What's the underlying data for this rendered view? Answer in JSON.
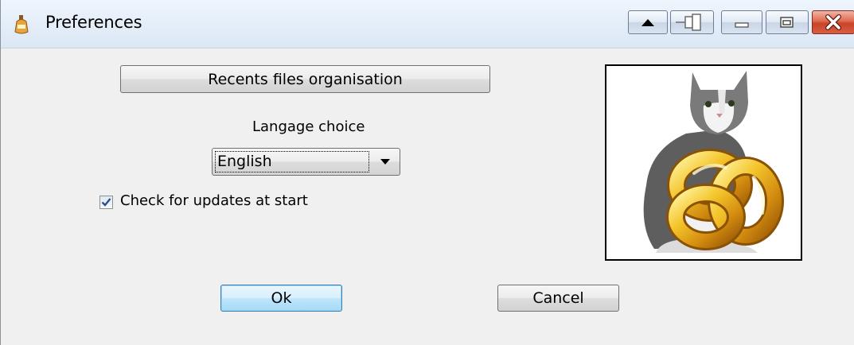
{
  "window": {
    "title": "Preferences",
    "icon": "app-bottle-icon",
    "controls": [
      "up-arrow-icon",
      "pin-icon",
      "minimize-icon",
      "maximize-icon",
      "close-icon"
    ]
  },
  "buttons": {
    "recents": "Recents files organisation",
    "ok": "Ok",
    "cancel": "Cancel"
  },
  "language": {
    "label": "Langage choice",
    "selected": "English"
  },
  "updates": {
    "label": "Check for updates at start",
    "checked": true
  },
  "picture": {
    "icon": "cat-with-golden-knot-logo"
  }
}
